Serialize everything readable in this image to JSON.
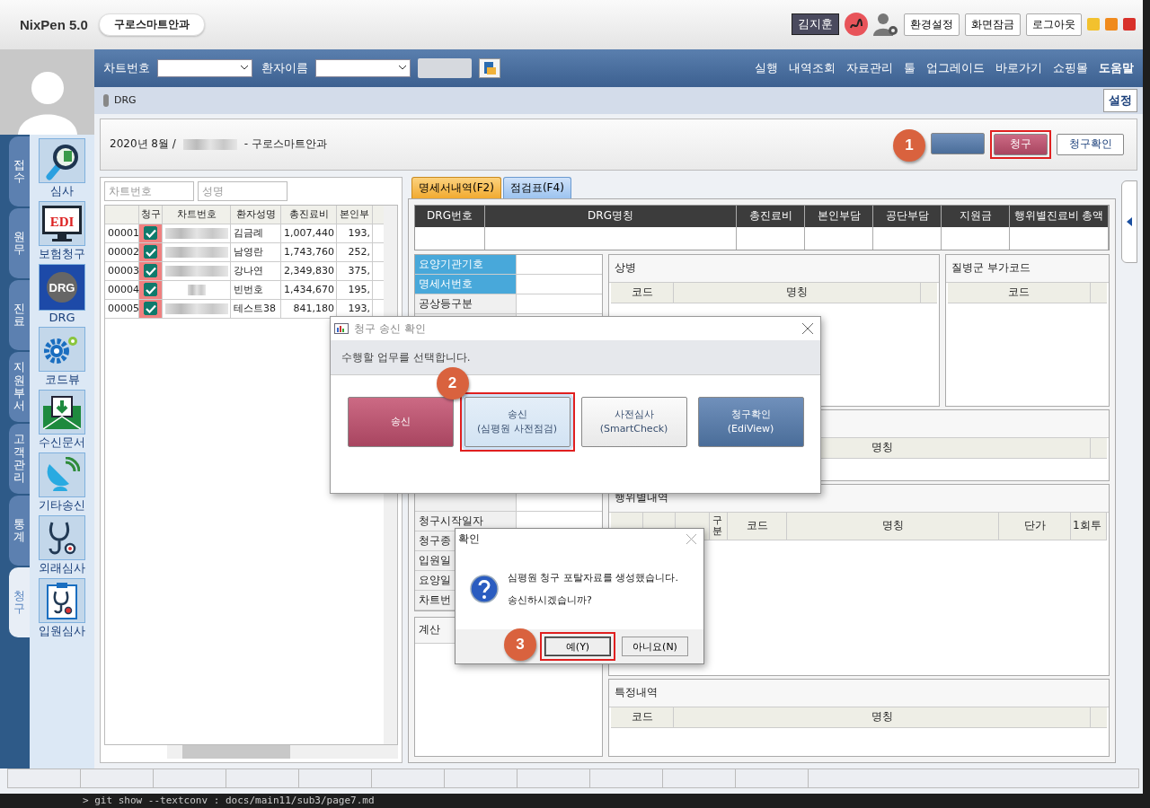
{
  "app": {
    "title": "NixPen 5.0",
    "clinic": "구로스마트안과"
  },
  "header_right": {
    "user": "김지훈",
    "buttons": [
      "환경설정",
      "화면잠금",
      "로그아웃"
    ]
  },
  "toolbar": {
    "fields": [
      {
        "label": "차트번호"
      },
      {
        "label": "환자이름"
      }
    ],
    "menu": [
      {
        "label": "실행",
        "bold": false
      },
      {
        "label": "내역조회",
        "bold": false
      },
      {
        "label": "자료관리",
        "bold": false
      },
      {
        "label": "툴",
        "bold": false
      },
      {
        "label": "업그레이드",
        "bold": false
      },
      {
        "label": "바로가기",
        "bold": false
      },
      {
        "label": "쇼핑몰",
        "bold": false
      },
      {
        "label": "도움말",
        "bold": true
      }
    ]
  },
  "breadcrumb": {
    "label": "DRG",
    "settings": "설정"
  },
  "nav_tabs": [
    {
      "label": "접수",
      "selected": false
    },
    {
      "label": "원무",
      "selected": false
    },
    {
      "label": "진료",
      "selected": false
    },
    {
      "label": "지원부서",
      "selected": false
    },
    {
      "label": "고객관리",
      "selected": false
    },
    {
      "label": "통계",
      "selected": false
    },
    {
      "label": "청구",
      "selected": true
    }
  ],
  "nav_icons": [
    {
      "label": "심사",
      "kind": "magnifier"
    },
    {
      "label": "보험청구",
      "kind": "monitor",
      "icon_text": "EDI"
    },
    {
      "label": "DRG",
      "kind": "disc",
      "icon_text": "DRG"
    },
    {
      "label": "코드뷰",
      "kind": "gears"
    },
    {
      "label": "수신문서",
      "kind": "mail"
    },
    {
      "label": "기타송신",
      "kind": "dish"
    },
    {
      "label": "외래심사",
      "kind": "stethoscope"
    },
    {
      "label": "입원심사",
      "kind": "clipboard"
    }
  ],
  "period": {
    "prefix": "2020년 8월 /",
    "suffix": "- 구로스마트안과"
  },
  "action_buttons": [
    {
      "kind": "blue",
      "highlighted": false,
      "callout": "1"
    },
    {
      "label": "청구",
      "kind": "pink",
      "highlighted": true
    },
    {
      "label": "청구확인",
      "kind": "white",
      "highlighted": false
    }
  ],
  "filters": [
    {
      "placeholder": "차트번호"
    },
    {
      "placeholder": "성명"
    }
  ],
  "patient_table": {
    "columns": [
      "청구",
      "차트번호",
      "환자성명",
      "총진료비",
      "본인부"
    ],
    "rows": [
      {
        "no": "00001",
        "checked": true,
        "name": "김금례",
        "total": "1,007,440",
        "copay": "193,"
      },
      {
        "no": "00002",
        "checked": true,
        "name": "남영란",
        "total": "1,743,760",
        "copay": "252,"
      },
      {
        "no": "00003",
        "checked": true,
        "name": "강나연",
        "total": "2,349,830",
        "copay": "375,"
      },
      {
        "no": "00004",
        "checked": true,
        "name": "빈번호",
        "total": "1,434,670",
        "copay": "195,"
      },
      {
        "no": "00005",
        "checked": true,
        "name": "테스트38",
        "total": "841,180",
        "copay": "193,"
      }
    ]
  },
  "tabs": [
    {
      "label": "명세서내역(F2)",
      "selected": true
    },
    {
      "label": "점검표(F4)",
      "selected": false
    }
  ],
  "drg_table": {
    "columns": [
      "DRG번호",
      "DRG명칭",
      "총진료비",
      "본인부담",
      "공단부담",
      "지원금",
      "행위별진료비 총액"
    ]
  },
  "info_fields": [
    {
      "label": "요양기관기호",
      "highlighted": true
    },
    {
      "label": "명세서번호",
      "highlighted": true
    },
    {
      "label": "공상등구분",
      "highlighted": false
    }
  ],
  "info_fields_lower": [
    {
      "label": "청구시작일자"
    },
    {
      "label": "청구종"
    },
    {
      "label": "입원일"
    },
    {
      "label": "요양일"
    },
    {
      "label": "차트번"
    }
  ],
  "invoice_section": {
    "title": "계산"
  },
  "diagnosis": {
    "title": "상병",
    "columns": [
      "코드",
      "명칭"
    ]
  },
  "extra_codes": {
    "title": "질병군 부가코드",
    "columns": [
      "코드"
    ]
  },
  "middle_section": {
    "columns": [
      "명칭"
    ]
  },
  "procedures": {
    "title": "행위별내역",
    "columns": [
      "구분",
      "코드",
      "명칭",
      "단가",
      "1회투"
    ]
  },
  "special": {
    "title": "특정내역",
    "columns": [
      "코드",
      "명칭"
    ]
  },
  "send_dialog": {
    "title": "청구 송신 확인",
    "message": "수행할 업무를 선택합니다.",
    "buttons": [
      {
        "label": "송신",
        "kind": "pink",
        "highlighted": false
      },
      {
        "label": "송신\n(심평원 사전점검)",
        "kind": "plain",
        "highlighted": true,
        "callout": "2"
      },
      {
        "label": "사전심사\n(SmartCheck)",
        "kind": "plain",
        "highlighted": false
      },
      {
        "label": "청구확인\n(EdiView)",
        "kind": "blue",
        "highlighted": false
      }
    ]
  },
  "confirm_dialog": {
    "title": "확인",
    "lines": [
      "심평원 청구 포탈자료를 생성했습니다.",
      "송신하시겠습니까?"
    ],
    "buttons": [
      {
        "label": "예(Y)",
        "highlighted": true,
        "callout": "3"
      },
      {
        "label": "아니요(N)",
        "highlighted": false
      }
    ]
  },
  "terminal_line": "> git show --textconv : docs/main11/sub3/page7.md"
}
